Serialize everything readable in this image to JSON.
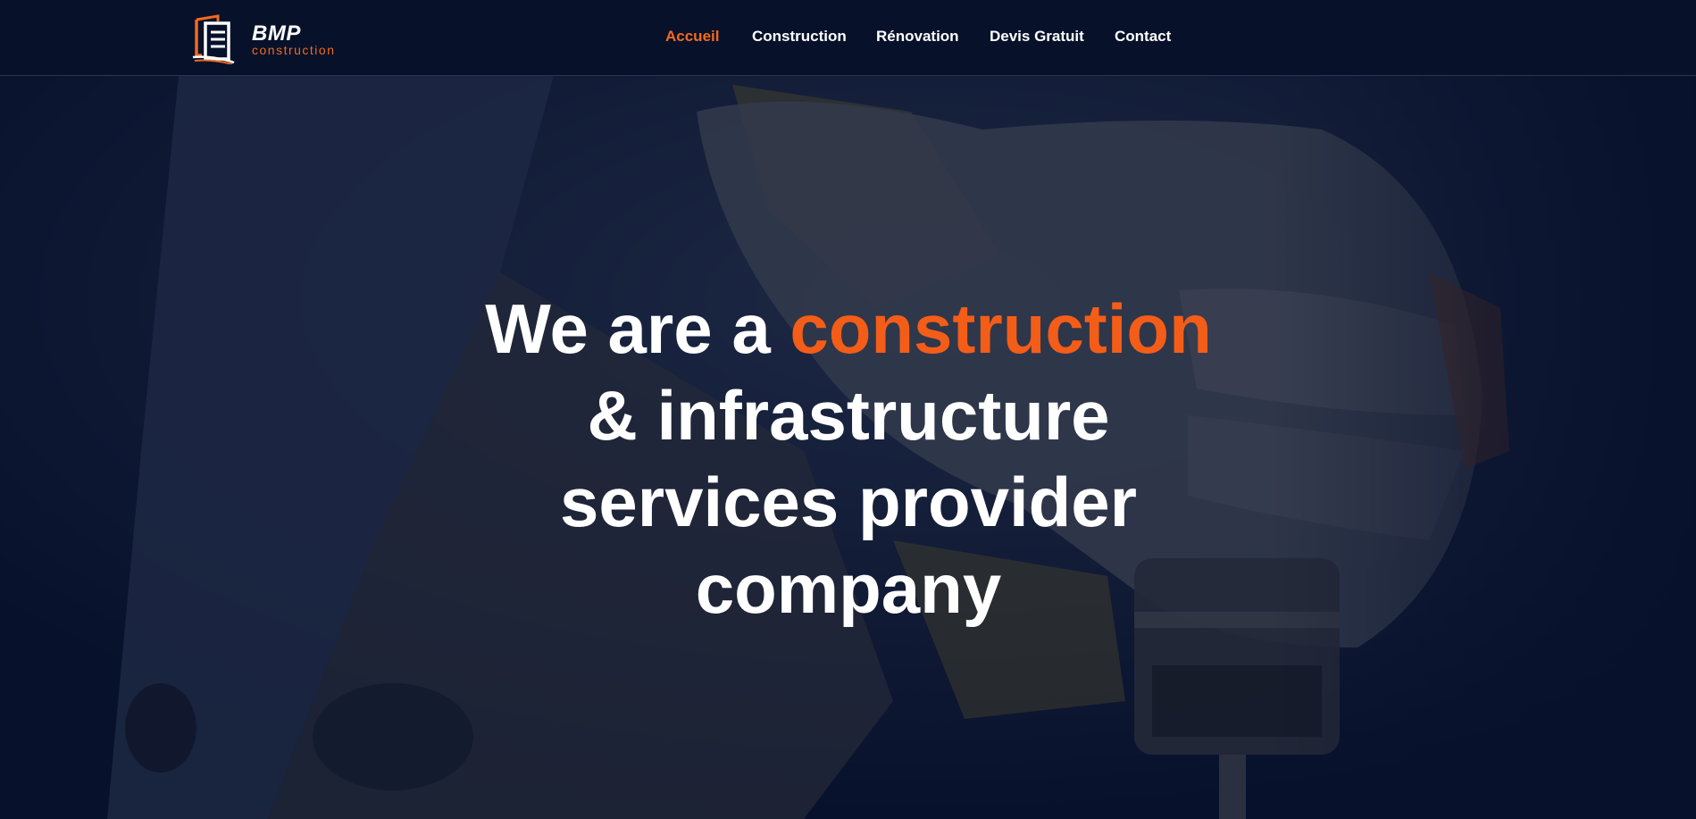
{
  "brand": {
    "name": "BMP",
    "tagline": "construction",
    "accent_color": "#f26a1e",
    "icon": "building-logo-icon"
  },
  "nav": {
    "items": [
      {
        "label": "Accueil",
        "active": true
      },
      {
        "label": "Construction",
        "active": false
      },
      {
        "label": "Rénovation",
        "active": false
      },
      {
        "label": "Devis Gratuit",
        "active": false
      },
      {
        "label": "Contact",
        "active": false
      }
    ]
  },
  "hero": {
    "headline_before": "We are a ",
    "headline_accent": "construction",
    "line2": "& infrastructure",
    "line3": "services provider",
    "line4": "company",
    "accent_color": "#f45d18",
    "background": "construction-worker-gloves-drill-image"
  }
}
